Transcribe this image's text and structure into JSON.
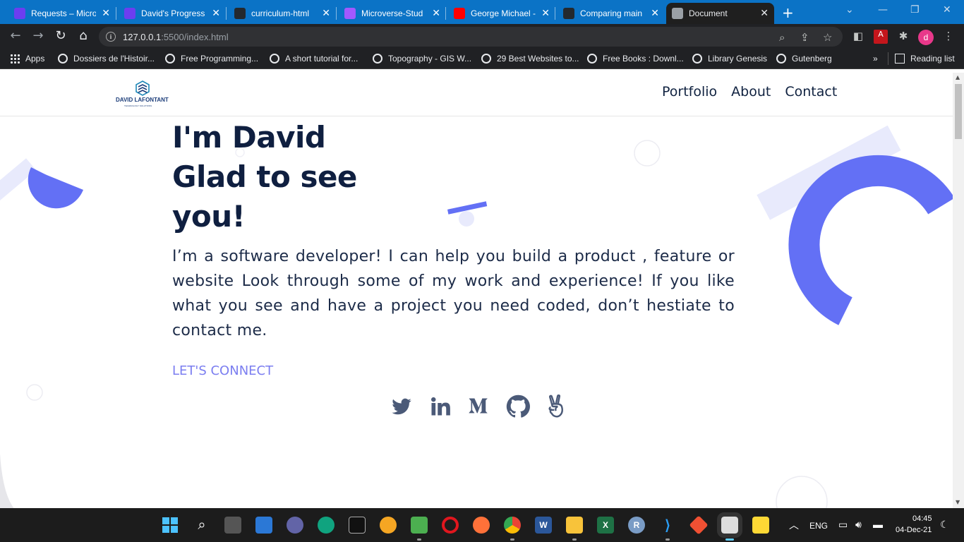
{
  "browser": {
    "tabs": [
      {
        "label": "Requests – Micro",
        "icon": "microverse-icon",
        "color": "#6c3ef0"
      },
      {
        "label": "David's Progress",
        "icon": "microverse-icon",
        "color": "#6c3ef0"
      },
      {
        "label": "curriculum-html",
        "icon": "github-icon",
        "color": "#24292e"
      },
      {
        "label": "Microverse-Stud",
        "icon": "figma-icon",
        "color": "#a259ff"
      },
      {
        "label": "George Michael -",
        "icon": "youtube-icon",
        "color": "#ff0000"
      },
      {
        "label": "Comparing main",
        "icon": "github-icon",
        "color": "#24292e"
      },
      {
        "label": "Document",
        "icon": "globe-icon",
        "color": "#9aa0a6"
      }
    ],
    "url_host": "127.0.0.1",
    "url_path": ":5500/index.html",
    "profile_initial": "d",
    "bookmarks": [
      {
        "label": "Apps"
      },
      {
        "label": "Dossiers de l'Histoir..."
      },
      {
        "label": "Free Programming..."
      },
      {
        "label": "A short tutorial for..."
      },
      {
        "label": "Topography - GIS W..."
      },
      {
        "label": "29 Best Websites to..."
      },
      {
        "label": "Free Books : Downl..."
      },
      {
        "label": "Library Genesis"
      },
      {
        "label": "Gutenberg"
      }
    ],
    "reading_list": "Reading list",
    "overflow": "»"
  },
  "site": {
    "logo_text": "DAVID  LAFONTANT",
    "logo_sub": "TECHNOLOGY SOLUTIONS",
    "nav": [
      "Portfolio",
      "About",
      "Contact"
    ],
    "hero_lines": [
      "I'm David",
      "Glad to see",
      "you!"
    ],
    "intro": "I’m a software developer! I can help you build a product , feature or website Look through some of my work and experience! If you like what you see and have a project you need coded, don’t hestiate to contact me.",
    "connect_label": "LET'S CONNECT",
    "socials": [
      "twitter-icon",
      "linkedin-icon",
      "medium-icon",
      "github-icon",
      "angellist-icon"
    ],
    "accent": "#6370f5",
    "accent_light": "#e8eafc"
  },
  "taskbar": {
    "language": "ENG",
    "time": "04:45",
    "date": "04-Dec-21"
  }
}
